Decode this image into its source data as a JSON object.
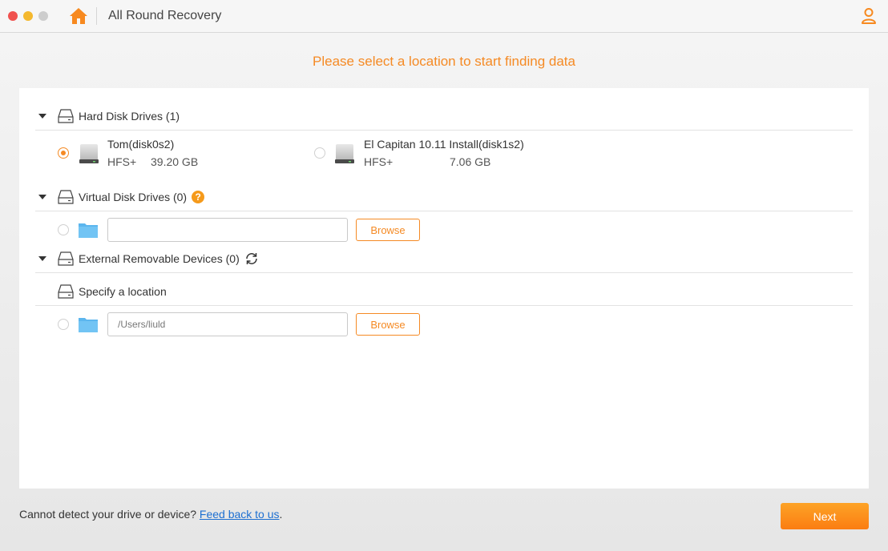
{
  "window": {
    "title": "All Round Recovery",
    "accent_color": "#f58a24"
  },
  "headline": "Please select a location to start finding data",
  "sections": {
    "hard_disk": {
      "label": "Hard Disk Drives (1)",
      "drives": [
        {
          "name": "Tom(disk0s2)",
          "fs": "HFS+",
          "size": "39.20 GB",
          "selected": true
        },
        {
          "name": "El Capitan 10.11 Install(disk1s2)",
          "fs": "HFS+",
          "size": "7.06 GB",
          "selected": false
        }
      ]
    },
    "virtual_disk": {
      "label": "Virtual Disk Drives (0)",
      "help_glyph": "?",
      "path_value": "",
      "browse_label": "Browse"
    },
    "external": {
      "label": "External Removable Devices (0)"
    },
    "specify": {
      "label": "Specify a location",
      "path_value": "/Users/liuld",
      "browse_label": "Browse"
    }
  },
  "footer": {
    "prompt": "Cannot detect your drive or device? ",
    "link": "Feed back to us",
    "suffix": ".",
    "next_label": "Next"
  }
}
